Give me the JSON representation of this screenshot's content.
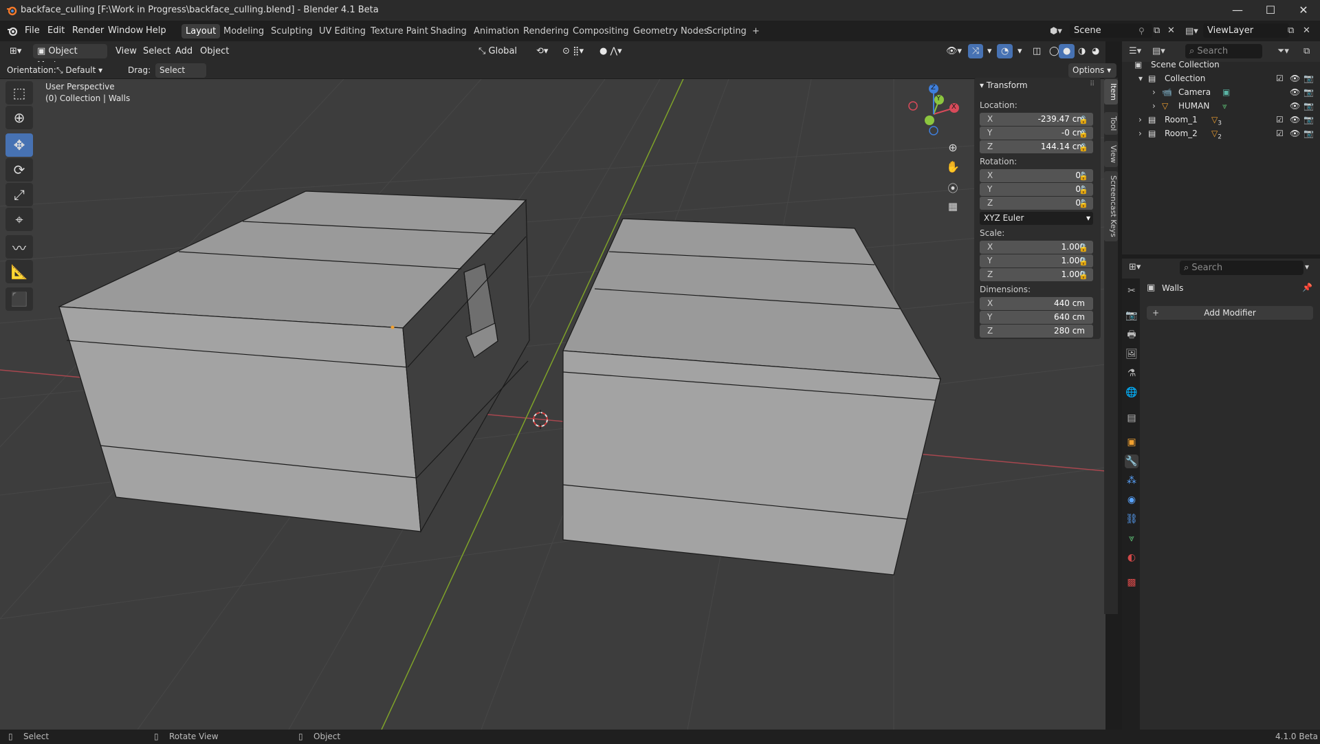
{
  "window": {
    "title": "backface_culling [F:\\Work in Progress\\backface_culling.blend] - Blender 4.1 Beta",
    "minimize": "—",
    "maximize": "☐",
    "close": "✕"
  },
  "menu": [
    "File",
    "Edit",
    "Render",
    "Window",
    "Help"
  ],
  "workspaces": [
    "Layout",
    "Modeling",
    "Sculpting",
    "UV Editing",
    "Texture Paint",
    "Shading",
    "Animation",
    "Rendering",
    "Compositing",
    "Geometry Nodes",
    "Scripting"
  ],
  "workspace_add": "+",
  "scene": {
    "name": "Scene",
    "view_layer": "ViewLayer"
  },
  "header": {
    "mode": "Object Mode",
    "menus": [
      "View",
      "Select",
      "Add",
      "Object"
    ],
    "transform_space": "Global",
    "options": "Options"
  },
  "subheader": {
    "orientation_label": "Orientation:",
    "orientation_value": "Default",
    "drag_label": "Drag:",
    "drag_value": "Select Box"
  },
  "viewport": {
    "perspective": "User Perspective",
    "collection_info": "(0) Collection | Walls"
  },
  "gizmo_axes": {
    "x": "X",
    "y": "Y",
    "z": "Z"
  },
  "npanel": {
    "section": "Transform",
    "location_label": "Location:",
    "location": [
      {
        "axis": "X",
        "value": "-239.47 cm"
      },
      {
        "axis": "Y",
        "value": "-0 cm"
      },
      {
        "axis": "Z",
        "value": "144.14 cm"
      }
    ],
    "rotation_label": "Rotation:",
    "rotation": [
      {
        "axis": "X",
        "value": "0°"
      },
      {
        "axis": "Y",
        "value": "0°"
      },
      {
        "axis": "Z",
        "value": "0°"
      }
    ],
    "rotation_mode": "XYZ Euler",
    "scale_label": "Scale:",
    "scale": [
      {
        "axis": "X",
        "value": "1.000"
      },
      {
        "axis": "Y",
        "value": "1.000"
      },
      {
        "axis": "Z",
        "value": "1.000"
      }
    ],
    "dimensions_label": "Dimensions:",
    "dimensions": [
      {
        "axis": "X",
        "value": "440 cm"
      },
      {
        "axis": "Y",
        "value": "640 cm"
      },
      {
        "axis": "Z",
        "value": "280 cm"
      }
    ],
    "tabs": [
      "Item",
      "Tool",
      "View",
      "Screencast Keys"
    ]
  },
  "outliner": {
    "search_placeholder": "Search",
    "rows": [
      {
        "label": "Scene Collection"
      },
      {
        "label": "Collection"
      },
      {
        "label": "Camera"
      },
      {
        "label": "HUMAN"
      },
      {
        "label": "Room_1",
        "badge": "3"
      },
      {
        "label": "Room_2",
        "badge": "2"
      }
    ]
  },
  "properties": {
    "search_placeholder": "Search",
    "object_name": "Walls",
    "add_modifier": "Add Modifier"
  },
  "status": {
    "select": "Select",
    "rotate": "Rotate View",
    "object": "Object",
    "version": "4.1.0 Beta"
  }
}
